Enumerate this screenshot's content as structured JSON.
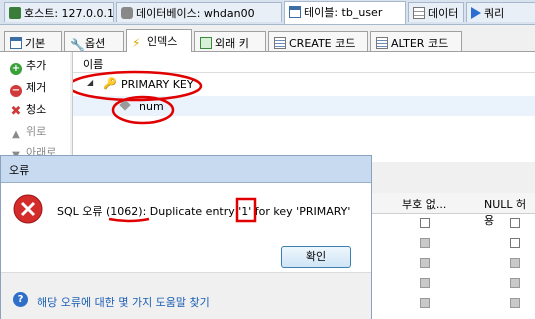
{
  "top_tabs": [
    {
      "label": "호스트: 127.0.0.1"
    },
    {
      "label": "데이터베이스: whdan00"
    },
    {
      "label": "테이블: tb_user"
    },
    {
      "label": "데이터"
    },
    {
      "label": "쿼리"
    }
  ],
  "sub_tabs": [
    {
      "label": "기본"
    },
    {
      "label": "옵션"
    },
    {
      "label": "인덱스"
    },
    {
      "label": "외래 키"
    },
    {
      "label": "CREATE 코드"
    },
    {
      "label": "ALTER 코드"
    }
  ],
  "side_buttons": [
    {
      "label": "추가"
    },
    {
      "label": "제거"
    },
    {
      "label": "청소"
    },
    {
      "label": "위로"
    },
    {
      "label": "아래로"
    }
  ],
  "index_panel": {
    "column_header": "이름",
    "primary_key_label": "PRIMARY KEY",
    "column_name": "num"
  },
  "grid": {
    "headers": [
      "부호 없...",
      "NULL 허용"
    ]
  },
  "dialog": {
    "title": "오류",
    "message": "SQL 오류 (1062): Duplicate entry '1' for key 'PRIMARY'",
    "ok_label": "확인",
    "help_link": "해당 오류에 대한 몇 가지 도움말 찾기"
  },
  "colors": {
    "annotation_red": "#e00000",
    "error_red": "#d42b2b",
    "link_blue": "#1a5fb4"
  }
}
